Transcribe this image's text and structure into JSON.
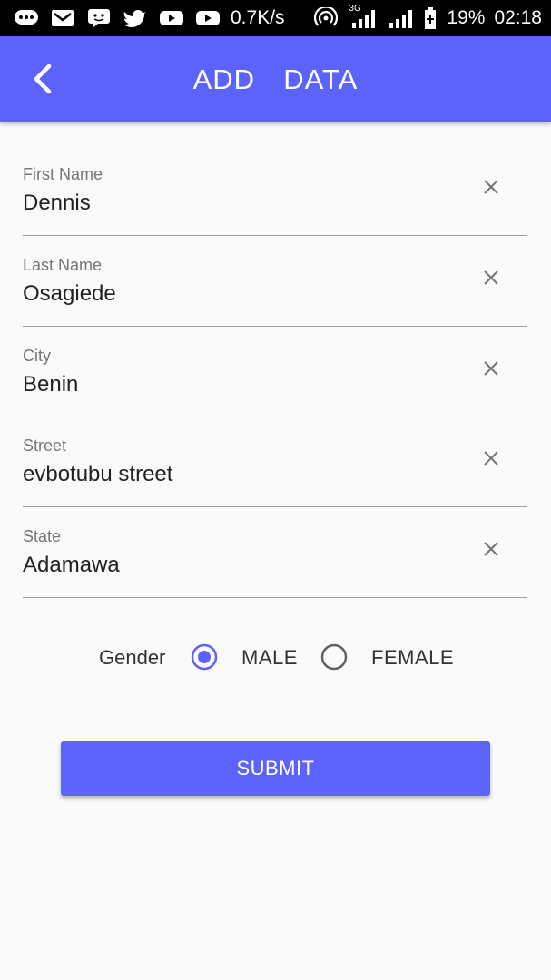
{
  "status_bar": {
    "icons": [
      "chat-bubble-icon",
      "gmail-icon",
      "messenger-icon",
      "twitter-icon",
      "youtube-icon",
      "youtube-icon"
    ],
    "speed": "0.7K/s",
    "network_type": "3G",
    "battery": "19%",
    "time": "02:18"
  },
  "app_bar": {
    "title": "ADD  DATA",
    "back_icon": "chevron-left-icon",
    "color": "#5b63fb"
  },
  "form": {
    "fields": [
      {
        "label": "First Name",
        "value": "Dennis"
      },
      {
        "label": "Last Name",
        "value": "Osagiede"
      },
      {
        "label": "City",
        "value": "Benin"
      },
      {
        "label": "Street",
        "value": "evbotubu street"
      },
      {
        "label": "State",
        "value": "Adamawa"
      }
    ],
    "clear_icon": "close-icon",
    "gender": {
      "label": "Gender",
      "options": [
        {
          "label": "MALE",
          "selected": true
        },
        {
          "label": "FEMALE",
          "selected": false
        }
      ]
    },
    "submit_label": "SUBMIT"
  }
}
